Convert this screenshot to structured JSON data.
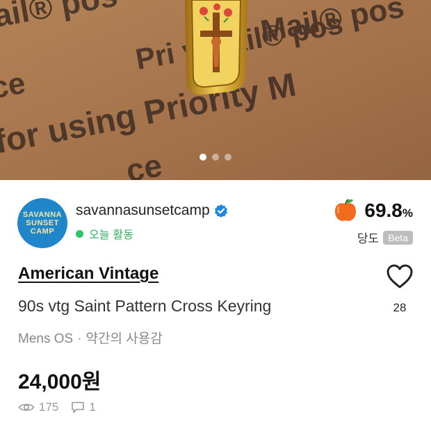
{
  "photo": {
    "alt": "Cross keyring on Priority Mail box",
    "printed_text": [
      "ail® pos",
      "Mail® pos",
      "Pri",
      "Priority Mail® Service",
      "for using Priority M",
      "ce"
    ],
    "slide_count": 3,
    "active_slide": 1
  },
  "seller": {
    "avatar_lines": [
      "SAVANNA",
      "SUNSET",
      "CAMP"
    ],
    "name": "savannasunsetcamp",
    "activity": "오늘 활동",
    "verified_color": "#1e88e5",
    "activity_color": "#2fc464"
  },
  "score": {
    "value": "69.8",
    "unit": "%",
    "label": "당도",
    "badge": "Beta",
    "icon": "apple-icon"
  },
  "product": {
    "brand": "American Vintage",
    "title": "90s vtg Saint Pattern Cross Keyring",
    "category": "Mens OS",
    "separator": "·",
    "condition": "약간의 사용감",
    "price": "24,000원",
    "likes": "28",
    "views": "175",
    "chats": "1"
  }
}
